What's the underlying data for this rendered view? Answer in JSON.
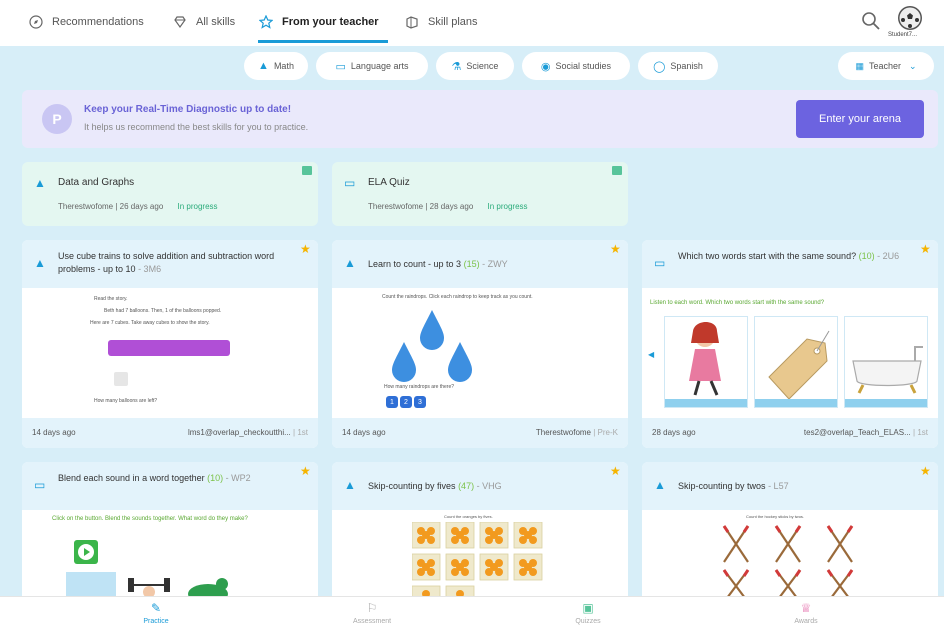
{
  "topnav": {
    "tabs": [
      {
        "label": "Recommendations",
        "icon": "compass-icon"
      },
      {
        "label": "All skills",
        "icon": "diamond-icon"
      },
      {
        "label": "From your teacher",
        "icon": "star-icon"
      },
      {
        "label": "Skill plans",
        "icon": "plan-icon"
      }
    ],
    "user_name": "Student7..."
  },
  "subjects": [
    {
      "label": "Math"
    },
    {
      "label": "Language arts"
    },
    {
      "label": "Science"
    },
    {
      "label": "Social studies"
    },
    {
      "label": "Spanish"
    }
  ],
  "teacher_filter": {
    "label": "Teacher"
  },
  "banner": {
    "title": "Keep your Real-Time Diagnostic up to date!",
    "subtitle": "It helps us recommend the best skills for you to practice.",
    "button": "Enter your arena"
  },
  "assignments": [
    {
      "title": "Data and Graphs",
      "author": "Therestwofome",
      "age": "26 days ago",
      "status": "In progress"
    },
    {
      "title": "ELA Quiz",
      "author": "Therestwofome",
      "age": "28 days ago",
      "status": "In progress"
    }
  ],
  "skills": [
    {
      "title": "Use cube trains to solve addition and subtraction word problems - up to 10",
      "level": "",
      "code": "- 3M6",
      "age": "14 days ago",
      "author": "lms1@overlap_checkoutthi...",
      "grade": "| 1st",
      "preview": {
        "line1": "Read the story.",
        "line2": "Beth had 7 balloons. Then, 1 of the balloons popped.",
        "line3": "Here are 7 cubes. Take away cubes to show the story.",
        "question": "How many balloons are left?"
      }
    },
    {
      "title": "Learn to count - up to 3",
      "level": "(15)",
      "code": "- ZWY",
      "age": "14 days ago",
      "author": "Therestwofome",
      "grade": "| Pre-K",
      "preview": {
        "instruction": "Count the raindrops. Click each raindrop to keep track as you count.",
        "question": "How many raindrops are there?",
        "choices": [
          "1",
          "2",
          "3"
        ]
      }
    },
    {
      "title": "Which two words start with the same sound?",
      "level": "(10)",
      "code": "- 2U6",
      "age": "28 days ago",
      "author": "tes2@overlap_Teach_ELAS...",
      "grade": "| 1st",
      "preview": {
        "instruction": "Listen to each word. Which two words start with the same sound?"
      }
    },
    {
      "title": "Blend each sound in a word together",
      "level": "(10)",
      "code": "- WP2",
      "preview": {
        "instruction": "Click on the button. Blend the sounds together. What word do they make?"
      }
    },
    {
      "title": "Skip-counting by fives",
      "level": "(47)",
      "code": "- VHG",
      "preview": {
        "instruction": "Count the oranges by fives."
      }
    },
    {
      "title": "Skip-counting by twos",
      "level": "",
      "code": "- L57",
      "preview": {
        "instruction": "Count the hockey sticks by twos."
      }
    }
  ],
  "bottomnav": [
    {
      "label": "Practice"
    },
    {
      "label": "Assessment"
    },
    {
      "label": "Quizzes"
    },
    {
      "label": "Awards"
    }
  ],
  "colors": {
    "accent": "#1a9bd7",
    "arena": "#6c63e0",
    "progress": "#2aab7a",
    "star": "#f5b400"
  }
}
